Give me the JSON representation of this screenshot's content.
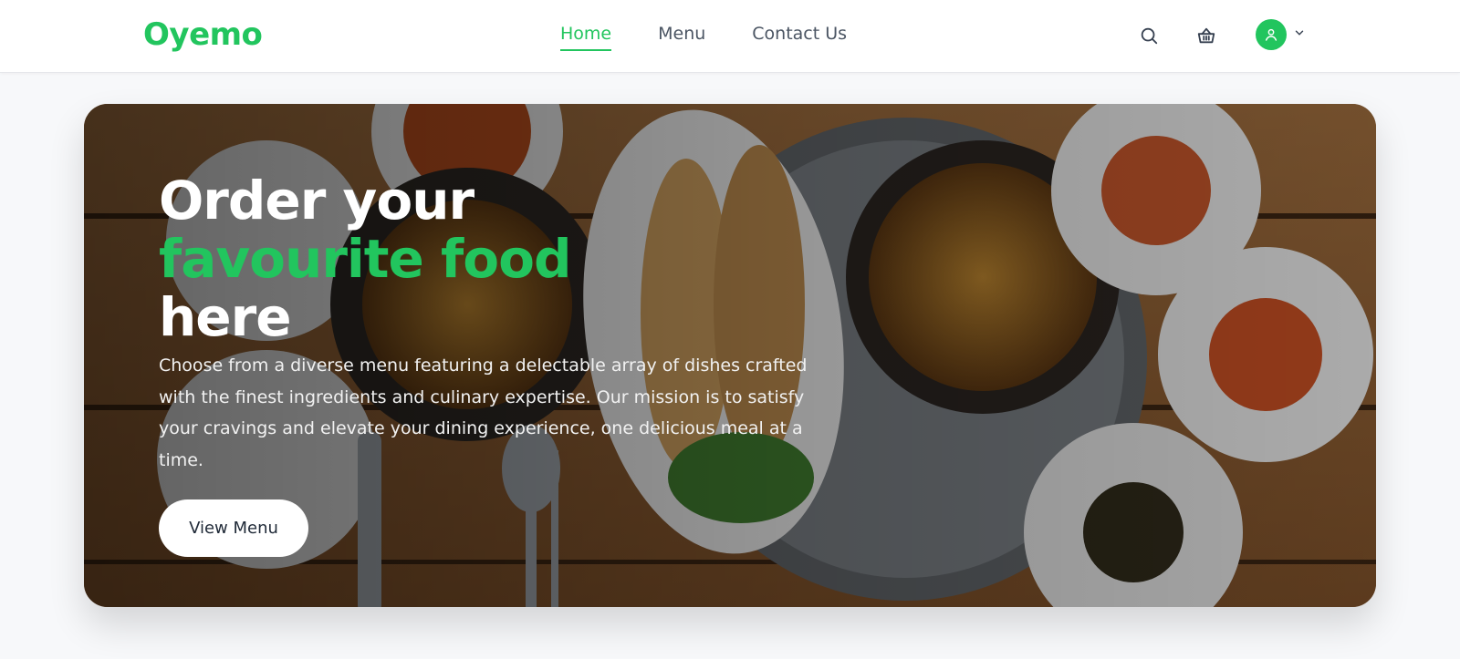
{
  "brand": {
    "name": "Oyemo",
    "accent_color": "#22c55e"
  },
  "nav": {
    "items": [
      {
        "label": "Home",
        "active": true
      },
      {
        "label": "Menu",
        "active": false
      },
      {
        "label": "Contact Us",
        "active": false
      }
    ]
  },
  "header_icons": [
    "search-icon",
    "basket-icon",
    "user-icon",
    "chevron-down-icon"
  ],
  "hero": {
    "title_line1": "Order your",
    "title_line2": "favourite food",
    "title_line3": "here",
    "description": "Choose from a diverse menu featuring a delectable array of dishes crafted with the finest ingredients and culinary expertise. Our mission is to satisfy your cravings and elevate your dining experience, one delicious meal at a time.",
    "button_label": "View Menu"
  }
}
